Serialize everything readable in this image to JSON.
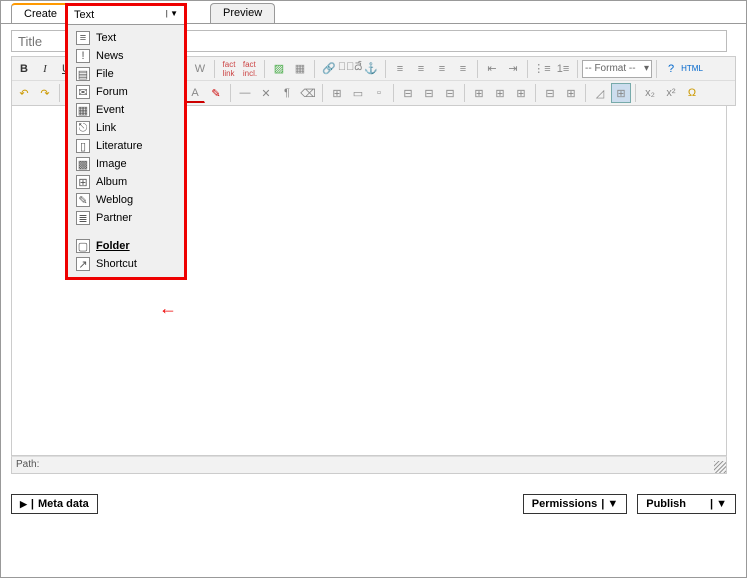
{
  "tabs": {
    "create": "Create",
    "preview": "Preview"
  },
  "title": {
    "placeholder": "Title"
  },
  "dropdown": {
    "header": "Text",
    "items": [
      {
        "id": "text",
        "label": "Text",
        "icon": "≡"
      },
      {
        "id": "news",
        "label": "News",
        "icon": "!"
      },
      {
        "id": "file",
        "label": "File",
        "icon": "▤"
      },
      {
        "id": "forum",
        "label": "Forum",
        "icon": "✉"
      },
      {
        "id": "event",
        "label": "Event",
        "icon": "▦"
      },
      {
        "id": "link",
        "label": "Link",
        "icon": "⎋"
      },
      {
        "id": "literature",
        "label": "Literature",
        "icon": "▯"
      },
      {
        "id": "image",
        "label": "Image",
        "icon": "▩"
      },
      {
        "id": "album",
        "label": "Album",
        "icon": "⊞"
      },
      {
        "id": "weblog",
        "label": "Weblog",
        "icon": "✎"
      },
      {
        "id": "partner",
        "label": "Partner",
        "icon": "≣"
      },
      {
        "id": "folder",
        "label": "Folder",
        "icon": "▢",
        "highlight": true
      },
      {
        "id": "shortcut",
        "label": "Shortcut",
        "icon": "↗"
      }
    ]
  },
  "toolbar": {
    "format_label": "-- Format --",
    "html_label": "HTML"
  },
  "path": {
    "label": "Path:"
  },
  "bottom": {
    "meta": "Meta data",
    "permissions": "Permissions",
    "publish": "Publish"
  }
}
